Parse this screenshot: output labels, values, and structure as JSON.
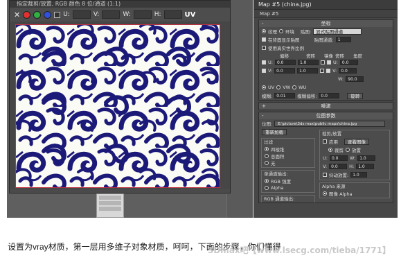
{
  "crop_window": {
    "title": "指定裁剪/放置, RGB 颜色 8 位/通道 (1:1)",
    "toolbar": {
      "close_glyph": "✕",
      "channels": [
        {
          "name": "red-channel",
          "color": "#e03030"
        },
        {
          "name": "green-channel",
          "color": "#30b040"
        },
        {
          "name": "blue-channel",
          "color": "#3050e0"
        }
      ],
      "fields": [
        {
          "label": "U:",
          "value": ""
        },
        {
          "label": "V:",
          "value": ""
        },
        {
          "label": "W:",
          "value": ""
        },
        {
          "label": "H:",
          "value": ""
        }
      ],
      "uv_label": "UV"
    },
    "pattern_colors": {
      "ink": "#1c1a78",
      "paper": "#fbfbf5",
      "border": "#c03040"
    }
  },
  "material_panel": {
    "title": "Map #5 (china.jpg)",
    "map_name": "Map #5",
    "coords": {
      "header": "坐标",
      "toggle": "-",
      "mode_texture": "纹理",
      "mode_environ": "环境",
      "mapping_label": "贴图:",
      "mapping_value": "显式贴图通道",
      "show_on_back": "在背面显示贴图",
      "real_world": "使用真实世界比例",
      "map_channel_label": "贴图通道:",
      "map_channel_value": "1",
      "col_offset": "偏移",
      "col_tiling": "瓷砖",
      "col_mirror": "镜像",
      "col_tile": "瓷砖",
      "col_angle": "角度",
      "u_label": "U:",
      "u_offset": "0.0",
      "u_tiling": "1.0",
      "u_angle": "0.0",
      "v_label": "V:",
      "v_offset": "0.0",
      "v_tiling": "1.0",
      "v_angle": "0.0",
      "w_label": "W:",
      "w_angle": "90.0",
      "uv": "UV",
      "vw": "VW",
      "wu": "WU",
      "blur_label": "模糊:",
      "blur_value": "0.01",
      "blur_offset_label": "模糊偏移:",
      "blur_offset_value": "0.0",
      "rotate_button": "旋转"
    },
    "noise": {
      "header": "噪波",
      "toggle": "+"
    },
    "bitmap": {
      "header": "位图参数",
      "toggle": "-",
      "path_label": "位图:",
      "path_value": "E:\\picture\\3ds max\\public maps\\china.jpg",
      "reload_button": "重新加载",
      "crop_group": "裁剪/放置",
      "apply_label": "应用",
      "view_image_button": "查看图像",
      "crop_option": "裁剪",
      "place_option": "放置",
      "u_label": "U:",
      "u_value": "0.0",
      "w_label": "W:",
      "w_value": "1.0",
      "v_label": "V:",
      "v_value": "0.0",
      "h_label": "H:",
      "h_value": "1.0",
      "jitter_label": "抖动放置:",
      "jitter_value": "1.0",
      "filter_group": "过滤",
      "filter_pyramidal": "四棱锥",
      "filter_summed": "总面积",
      "filter_none": "无",
      "mono_group": "单通道输出:",
      "mono_rgb": "RGB 强度",
      "mono_alpha": "Alpha",
      "rgb_out_group": "RGB 通道输出:",
      "alpha_source_group": "Alpha 来源",
      "alpha_image": "图像 Alpha"
    }
  },
  "caption": {
    "text": "设置为vray材质，第一层用多维子对象材质，呵呵，下面的步骤，你们懂得",
    "watermark": "3Dmax吧【www.lsecg.com/tieba/1771】"
  }
}
